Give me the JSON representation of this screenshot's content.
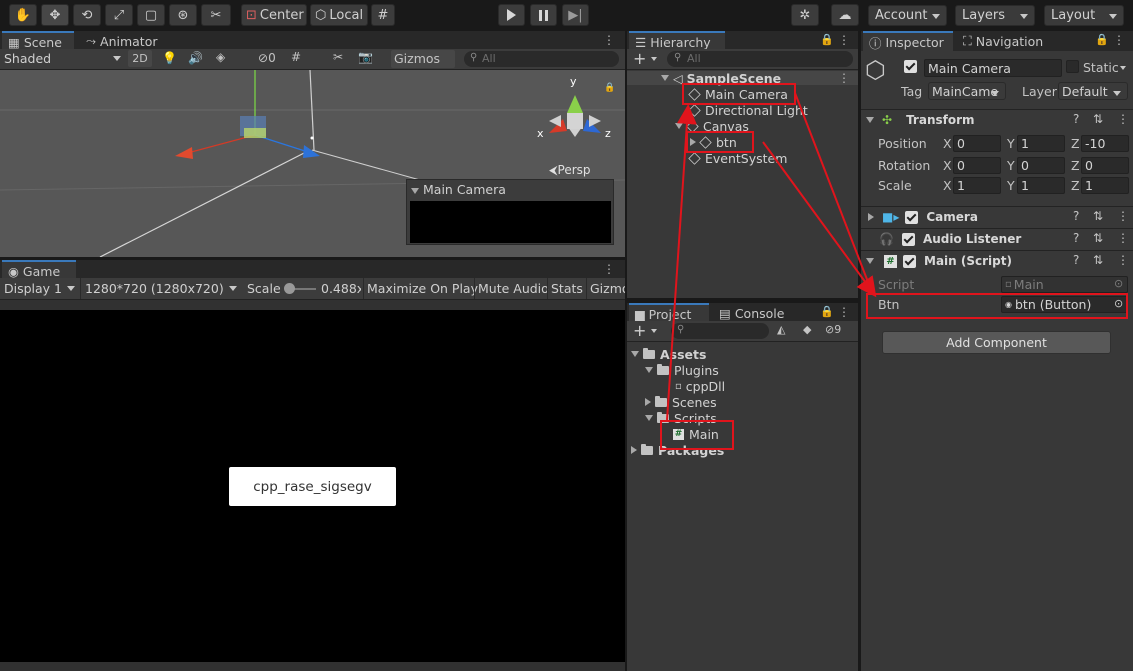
{
  "toolbar": {
    "tools": [
      "hand-tool",
      "move-tool",
      "rotate-tool",
      "scale-tool",
      "rect-tool",
      "transform-tool",
      "custom-tool"
    ],
    "pivot": "Center",
    "space": "Local",
    "account": "Account",
    "layers": "Layers",
    "layout": "Layout"
  },
  "scene": {
    "tab_scene": "Scene",
    "tab_animator": "Animator",
    "shading": "Shaded",
    "mode_2d": "2D",
    "hidden_count": "0",
    "gizmos": "Gizmos",
    "search_placeholder": "All",
    "persp": "Persp",
    "axis_x": "x",
    "axis_y": "y",
    "axis_z": "z",
    "camera_preview_title": "Main Camera"
  },
  "game": {
    "tab": "Game",
    "display": "Display 1",
    "resolution": "1280*720 (1280x720)",
    "scale_label": "Scale",
    "scale_value": "0.488x",
    "maximize": "Maximize On Play",
    "mute": "Mute Audio",
    "stats": "Stats",
    "gizmos": "Gizmo",
    "button_text": "cpp_rase_sigsegv"
  },
  "hierarchy": {
    "tab": "Hierarchy",
    "search_placeholder": "All",
    "scene_name": "SampleScene",
    "items": [
      "Main Camera",
      "Directional Light",
      "Canvas",
      "btn",
      "EventSystem"
    ]
  },
  "project": {
    "tab_project": "Project",
    "tab_console": "Console",
    "hidden_count": "9",
    "items": [
      "Assets",
      "Plugins",
      "cppDll",
      "Scenes",
      "Scripts",
      "Main",
      "Packages"
    ]
  },
  "inspector": {
    "tab_inspector": "Inspector",
    "tab_navigation": "Navigation",
    "object_name": "Main Camera",
    "static_label": "Static",
    "tag_label": "Tag",
    "tag_value": "MainCame",
    "layer_label": "Layer",
    "layer_value": "Default",
    "transform": {
      "title": "Transform",
      "position_label": "Position",
      "rotation_label": "Rotation",
      "scale_label": "Scale",
      "position": [
        "0",
        "1",
        "-10"
      ],
      "rotation": [
        "0",
        "0",
        "0"
      ],
      "scale": [
        "1",
        "1",
        "1"
      ],
      "axes": [
        "X",
        "Y",
        "Z"
      ]
    },
    "camera_title": "Camera",
    "audio_title": "Audio Listener",
    "script_title": "Main (Script)",
    "script_label": "Script",
    "script_value": "Main",
    "btn_label": "Btn",
    "btn_value": "btn (Button)",
    "add_component": "Add Component"
  },
  "colors": {
    "highlight_red": "#e0141c",
    "selection_blue": "#3a79bb"
  }
}
